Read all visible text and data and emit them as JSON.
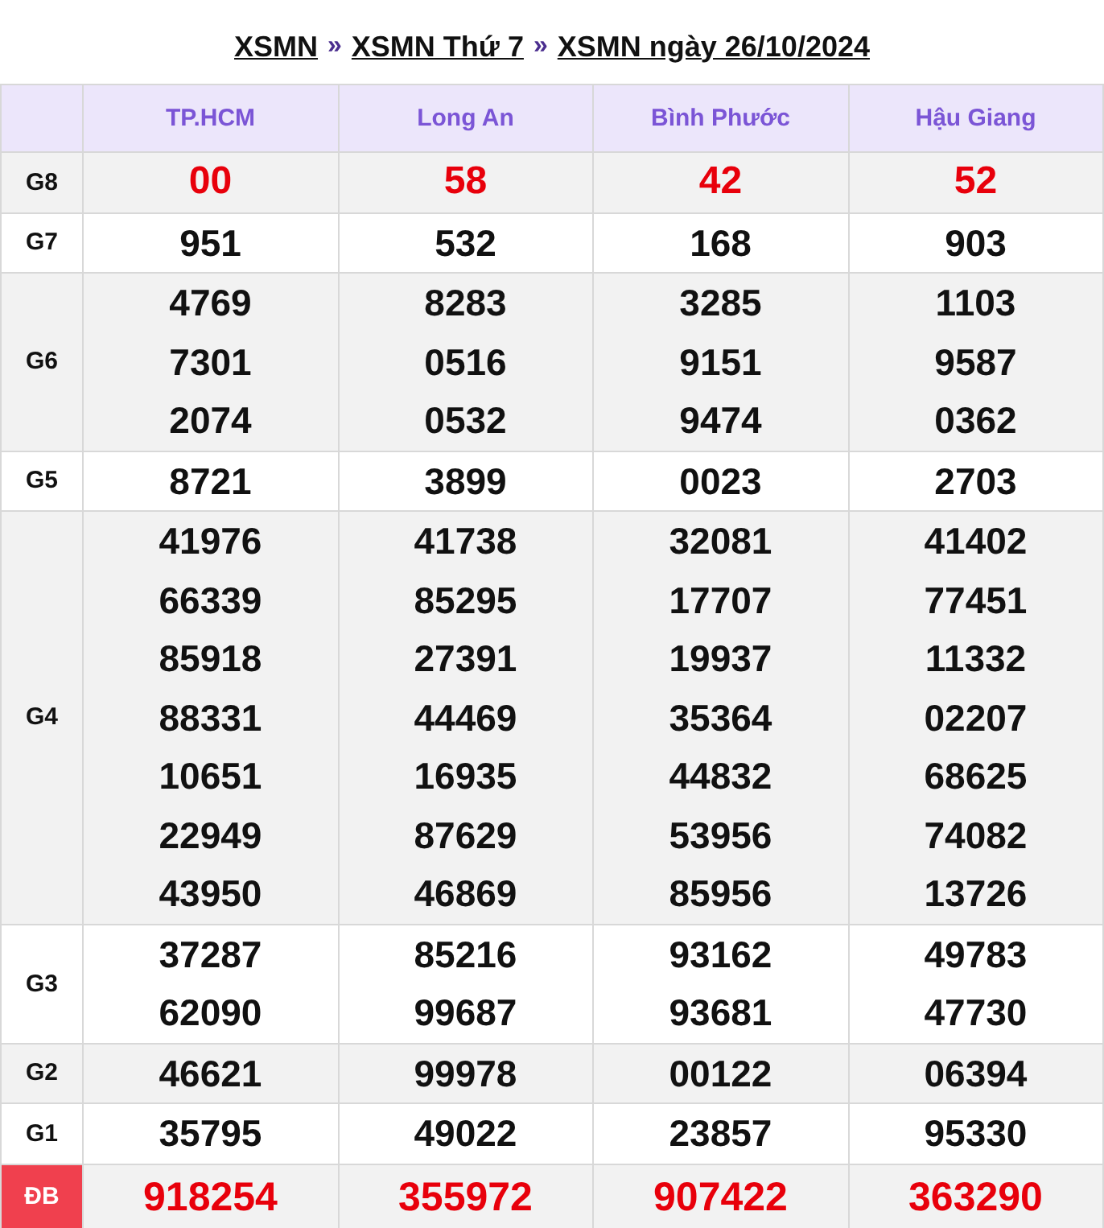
{
  "breadcrumb": [
    {
      "label": "XSMN"
    },
    {
      "label": "XSMN Thứ 7"
    },
    {
      "label": "XSMN ngày 26/10/2024"
    }
  ],
  "separator": "»",
  "provinces": [
    "TP.HCM",
    "Long An",
    "Bình Phước",
    "Hậu Giang"
  ],
  "prizes": [
    {
      "label": "G8",
      "kind": "red",
      "numbers": [
        [
          "00"
        ],
        [
          "58"
        ],
        [
          "42"
        ],
        [
          "52"
        ]
      ]
    },
    {
      "label": "G7",
      "kind": "plain",
      "numbers": [
        [
          "951"
        ],
        [
          "532"
        ],
        [
          "168"
        ],
        [
          "903"
        ]
      ]
    },
    {
      "label": "G6",
      "kind": "plain",
      "numbers": [
        [
          "4769",
          "7301",
          "2074"
        ],
        [
          "8283",
          "0516",
          "0532"
        ],
        [
          "3285",
          "9151",
          "9474"
        ],
        [
          "1103",
          "9587",
          "0362"
        ]
      ]
    },
    {
      "label": "G5",
      "kind": "plain",
      "numbers": [
        [
          "8721"
        ],
        [
          "3899"
        ],
        [
          "0023"
        ],
        [
          "2703"
        ]
      ]
    },
    {
      "label": "G4",
      "kind": "plain",
      "numbers": [
        [
          "41976",
          "66339",
          "85918",
          "88331",
          "10651",
          "22949",
          "43950"
        ],
        [
          "41738",
          "85295",
          "27391",
          "44469",
          "16935",
          "87629",
          "46869"
        ],
        [
          "32081",
          "17707",
          "19937",
          "35364",
          "44832",
          "53956",
          "85956"
        ],
        [
          "41402",
          "77451",
          "11332",
          "02207",
          "68625",
          "74082",
          "13726"
        ]
      ]
    },
    {
      "label": "G3",
      "kind": "plain",
      "numbers": [
        [
          "37287",
          "62090"
        ],
        [
          "85216",
          "99687"
        ],
        [
          "93162",
          "93681"
        ],
        [
          "49783",
          "47730"
        ]
      ]
    },
    {
      "label": "G2",
      "kind": "plain",
      "numbers": [
        [
          "46621"
        ],
        [
          "99978"
        ],
        [
          "00122"
        ],
        [
          "06394"
        ]
      ]
    },
    {
      "label": "G1",
      "kind": "plain",
      "numbers": [
        [
          "35795"
        ],
        [
          "49022"
        ],
        [
          "23857"
        ],
        [
          "95330"
        ]
      ]
    },
    {
      "label": "ĐB",
      "kind": "special",
      "numbers": [
        [
          "918254"
        ],
        [
          "355972"
        ],
        [
          "907422"
        ],
        [
          "363290"
        ]
      ]
    }
  ]
}
